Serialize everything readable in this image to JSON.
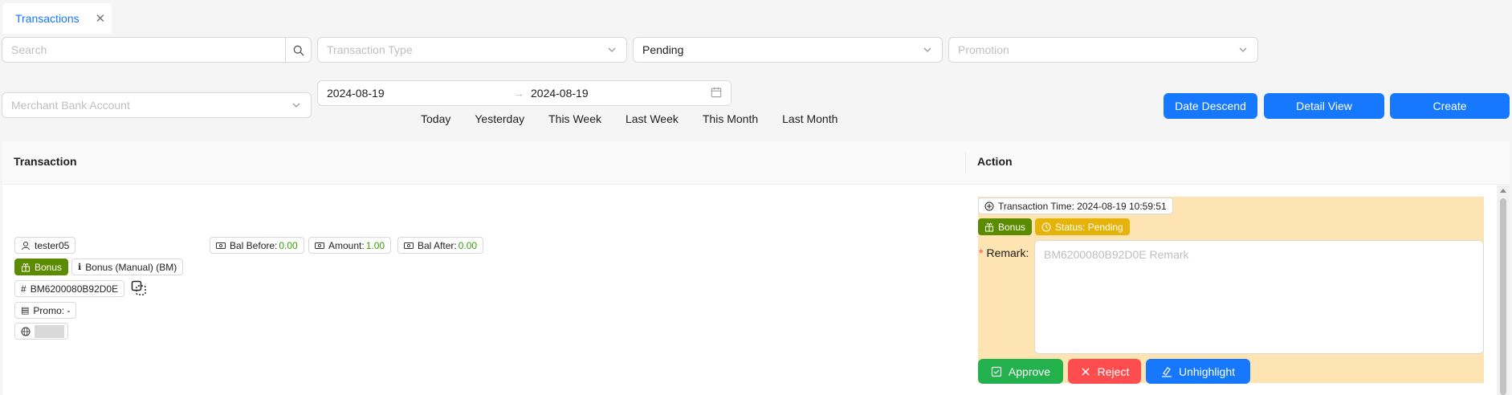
{
  "tab": {
    "label": "Transactions"
  },
  "filters": {
    "search_placeholder": "Search",
    "transaction_type_placeholder": "Transaction Type",
    "status_value": "Pending",
    "promotion_placeholder": "Promotion",
    "merchant_bank_placeholder": "Merchant Bank Account",
    "date_from": "2024-08-19",
    "date_to": "2024-08-19",
    "quick_ranges": [
      "Today",
      "Yesterday",
      "This Week",
      "Last Week",
      "This Month",
      "Last Month"
    ]
  },
  "toolbar": {
    "date_descend": "Date Descend",
    "detail_view": "Detail View",
    "create": "Create"
  },
  "table": {
    "headers": {
      "transaction": "Transaction",
      "action": "Action"
    },
    "row": {
      "username": "tester05",
      "bal_before_label": "Bal Before:",
      "bal_before": "0.00",
      "amount_label": "Amount:",
      "amount": "1.00",
      "bal_after_label": "Bal After:",
      "bal_after": "0.00",
      "type_tag": "Bonus",
      "type_detail": "Bonus (Manual) (BM)",
      "ref_id": "BM6200080B92D0E",
      "promo": "Promo: -",
      "txn_time": "Transaction Time: 2024-08-19 10:59:51",
      "action_type_tag": "Bonus",
      "status_tag": "Status: Pending",
      "remark_label": "Remark:",
      "remark_placeholder": "BM6200080B92D0E Remark",
      "approve": "Approve",
      "reject": "Reject",
      "unhighlight": "Unhighlight"
    }
  },
  "colors": {
    "primary": "#1677ff",
    "approve": "#22b14c",
    "reject": "#ff4d4f",
    "bonus": "#5b8c00",
    "pending": "#e6b30a",
    "highlight": "#ffe4b3"
  }
}
